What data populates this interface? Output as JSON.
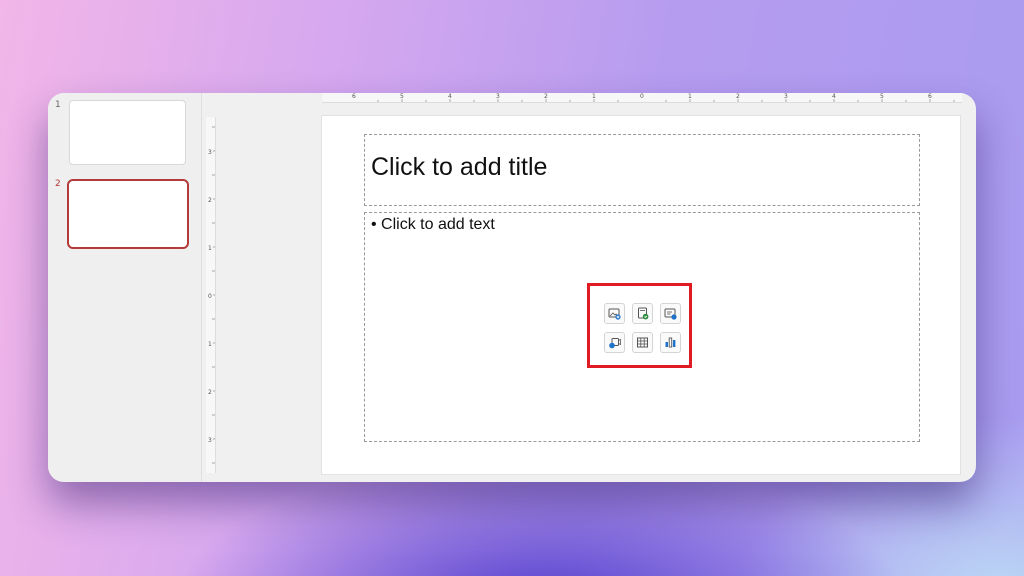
{
  "thumbnails": [
    {
      "number": "1"
    },
    {
      "number": "2"
    }
  ],
  "slide": {
    "title_placeholder": "Click to add title",
    "body_placeholder": "• Click to add text"
  },
  "ruler": {
    "top_ticks": [
      "6",
      "5",
      "4",
      "3",
      "2",
      "1",
      "0",
      "1",
      "2",
      "3",
      "4",
      "5",
      "6"
    ],
    "left_ticks": [
      "3",
      "2",
      "1",
      "0",
      "1",
      "2",
      "3"
    ]
  },
  "content_icons": [
    {
      "icon": "insert-picture-icon"
    },
    {
      "icon": "insert-stock-images-icon"
    },
    {
      "icon": "insert-icons-icon"
    },
    {
      "icon": "insert-video-icon"
    },
    {
      "icon": "insert-table-icon"
    },
    {
      "icon": "insert-chart-icon"
    }
  ],
  "colors": {
    "accent": "#b33a3a",
    "highlight": "#e01b24"
  }
}
